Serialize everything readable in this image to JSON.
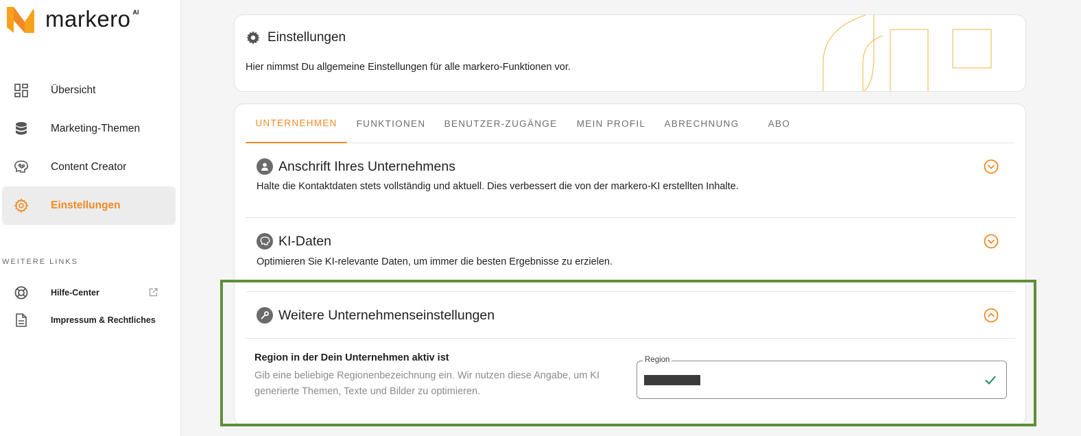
{
  "brand": {
    "name": "markero",
    "suffix": "AI",
    "accent_color": "#f28a23"
  },
  "sidebar": {
    "nav": [
      {
        "label": "Übersicht",
        "icon": "dashboard-icon",
        "active": false
      },
      {
        "label": "Marketing-Themen",
        "icon": "database-icon",
        "active": false
      },
      {
        "label": "Content Creator",
        "icon": "brain-icon",
        "active": false
      },
      {
        "label": "Einstellungen",
        "icon": "gear-icon",
        "active": true
      }
    ],
    "more_title": "WEITERE LINKS",
    "links": [
      {
        "label": "Hilfe-Center",
        "icon": "lifebuoy-icon",
        "external": true
      },
      {
        "label": "Impressum & Rechtliches",
        "icon": "document-icon",
        "external": false
      }
    ]
  },
  "header": {
    "title": "Einstellungen",
    "description": "Hier nimmst Du allgemeine Einstellungen für alle markero-Funktionen vor."
  },
  "tabs": [
    {
      "label": "UNTERNEHMEN",
      "active": true
    },
    {
      "label": "FUNKTIONEN",
      "active": false
    },
    {
      "label": "BENUTZER-ZUGÄNGE",
      "active": false
    },
    {
      "label": "MEIN PROFIL",
      "active": false
    },
    {
      "label": "ABRECHNUNG",
      "active": false
    },
    {
      "label": "ABO",
      "active": false
    }
  ],
  "sections": [
    {
      "title": "Anschrift Ihres Unternehmens",
      "description": "Halte die Kontaktdaten stets vollständig und aktuell. Dies verbessert die von der markero-KI erstellten Inhalte.",
      "expanded": false
    },
    {
      "title": "KI-Daten",
      "description": "Optimieren Sie KI-relevante Daten, um immer die besten Ergebnisse zu erzielen.",
      "expanded": false
    },
    {
      "title": "Weitere Unternehmenseinstellungen",
      "expanded": true,
      "field": {
        "title": "Region in der Dein Unternehmen aktiv ist",
        "help": "Gib eine beliebige Regionenbezeichnung ein. Wir nutzen diese Angabe, um KI generierte Themen, Texte und Bilder zu optimieren.",
        "input_label": "Region",
        "input_value": "",
        "valid": true
      }
    }
  ],
  "highlight_color": "#5e8f3a"
}
